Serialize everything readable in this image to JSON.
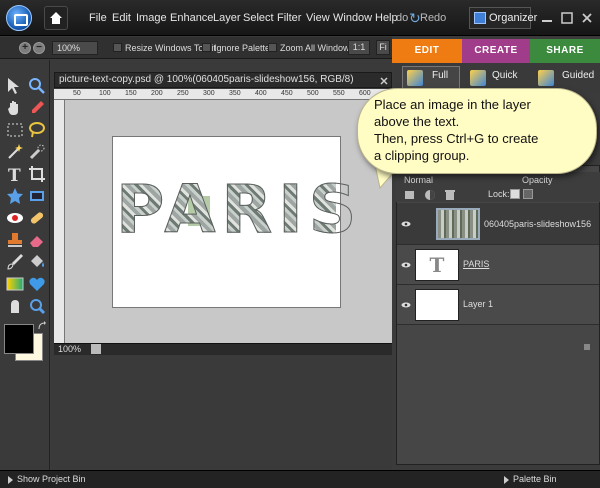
{
  "menu": {
    "items": [
      "File",
      "Edit",
      "Image",
      "Enhance",
      "Layer",
      "Select",
      "Filter",
      "View",
      "Window",
      "Help"
    ],
    "undo_fragment": "do",
    "redo_label": "Redo",
    "organizer_label": "Organizer"
  },
  "options_bar": {
    "zoom_value": "100%",
    "resize_windows_label": "Resize Windows To Fit",
    "ignore_palettes_label": "Ignore Palettes",
    "zoom_all_windows_label": "Zoom All Windows",
    "actual_pixels_label": "1:1",
    "fit_label": "Fi"
  },
  "document": {
    "tab_title": "picture-text-copy.psd @ 100%(060405paris-slideshow156, RGB/8)",
    "canvas_text": "PARIS",
    "zoom_status": "100%",
    "ruler_labels": [
      "50",
      "100",
      "150",
      "200",
      "250",
      "300",
      "350",
      "400",
      "450",
      "500",
      "550",
      "600"
    ]
  },
  "right_panel": {
    "tabs": {
      "edit": "EDIT",
      "create": "CREATE",
      "share": "SHARE"
    },
    "modes": {
      "full": "Full",
      "quick": "Quick",
      "guided": "Guided"
    },
    "blend_mode": "Normal",
    "opacity_label": "Opacity",
    "lock_label": "Lock:",
    "layers": [
      {
        "name": "060405paris-slideshow156",
        "type": "photo"
      },
      {
        "name": "PARIS",
        "type": "text",
        "thumb_glyph": "T"
      },
      {
        "name": "Layer 1",
        "type": "fill"
      }
    ]
  },
  "callout": {
    "lines": [
      "Place an image in the layer",
      "above the text.",
      "Then, press Ctrl+G to create",
      "a clipping group."
    ]
  },
  "bottom_bar": {
    "show_project_bin": "Show Project Bin",
    "palette_bin": "Palette Bin"
  },
  "colors": {
    "edit_tab": "#ef7c12",
    "create_tab": "#a03c8a",
    "share_tab": "#3c8a3e",
    "foreground": "#000000",
    "background": "#fff8e0",
    "callout_bg": "#fffcc4"
  }
}
